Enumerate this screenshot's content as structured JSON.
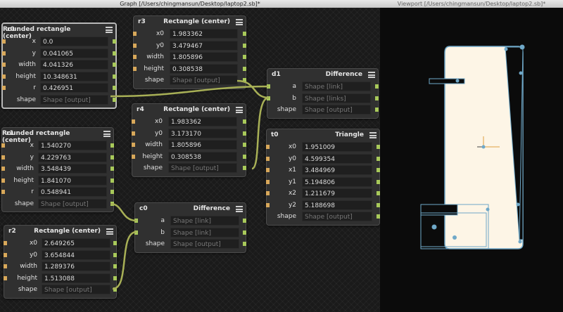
{
  "windows": {
    "graph_title": "Graph [/Users/chingmansun/Desktop/laptop2.sb]*",
    "viewport_title": "Viewport [/Users/chingmansun/Desktop/laptop2.sb]*"
  },
  "nodes": {
    "r0": {
      "name": "r0",
      "type": "Rounded rectangle (center)",
      "rows": [
        {
          "label": "x",
          "value": "0.0"
        },
        {
          "label": "y",
          "value": "0.041065"
        },
        {
          "label": "width",
          "value": "4.041326"
        },
        {
          "label": "height",
          "value": "10.348631"
        },
        {
          "label": "r",
          "value": "0.426951"
        },
        {
          "label": "shape",
          "value": "Shape [output]"
        }
      ]
    },
    "r3": {
      "name": "r3",
      "type": "Rectangle (center)",
      "rows": [
        {
          "label": "x0",
          "value": "1.983362"
        },
        {
          "label": "y0",
          "value": "3.479467"
        },
        {
          "label": "width",
          "value": "1.805896"
        },
        {
          "label": "height",
          "value": "0.308538"
        },
        {
          "label": "shape",
          "value": "Shape [output]"
        }
      ]
    },
    "d1": {
      "name": "d1",
      "type": "Difference",
      "rows": [
        {
          "label": "a",
          "value": "Shape [link]"
        },
        {
          "label": "b",
          "value": "Shape [links]"
        },
        {
          "label": "shape",
          "value": "Shape [output]"
        }
      ]
    },
    "r4": {
      "name": "r4",
      "type": "Rectangle (center)",
      "rows": [
        {
          "label": "x0",
          "value": "1.983362"
        },
        {
          "label": "y0",
          "value": "3.173170"
        },
        {
          "label": "width",
          "value": "1.805896"
        },
        {
          "label": "height",
          "value": "0.308538"
        },
        {
          "label": "shape",
          "value": "Shape [output]"
        }
      ]
    },
    "t0": {
      "name": "t0",
      "type": "Triangle",
      "rows": [
        {
          "label": "x0",
          "value": "1.951009"
        },
        {
          "label": "y0",
          "value": "4.599354"
        },
        {
          "label": "x1",
          "value": "3.484969"
        },
        {
          "label": "y1",
          "value": "5.194806"
        },
        {
          "label": "x2",
          "value": "1.211679"
        },
        {
          "label": "y2",
          "value": "5.188698"
        },
        {
          "label": "shape",
          "value": "Shape [output]"
        }
      ]
    },
    "r1": {
      "name": "r1",
      "type": "Rounded rectangle (center)",
      "rows": [
        {
          "label": "x",
          "value": "1.540270"
        },
        {
          "label": "y",
          "value": "4.229763"
        },
        {
          "label": "width",
          "value": "3.548439"
        },
        {
          "label": "height",
          "value": "1.841070"
        },
        {
          "label": "r",
          "value": "0.548941"
        },
        {
          "label": "shape",
          "value": "Shape [output]"
        }
      ]
    },
    "c0": {
      "name": "c0",
      "type": "Difference",
      "rows": [
        {
          "label": "a",
          "value": "Shape [link]"
        },
        {
          "label": "b",
          "value": "Shape [link]"
        },
        {
          "label": "shape",
          "value": "Shape [output]"
        }
      ]
    },
    "r2": {
      "name": "r2",
      "type": "Rectangle (center)",
      "rows": [
        {
          "label": "x0",
          "value": "2.649265"
        },
        {
          "label": "y0",
          "value": "3.654844"
        },
        {
          "label": "width",
          "value": "1.289376"
        },
        {
          "label": "height",
          "value": "1.513088"
        },
        {
          "label": "shape",
          "value": "Shape [output]"
        }
      ]
    }
  },
  "colors": {
    "wire": "#a8b056",
    "input_port": "#d8a85a",
    "output_port": "#a8c95a",
    "shape_fill": "#fdf5e6",
    "shape_outline": "#6fa8c8"
  }
}
